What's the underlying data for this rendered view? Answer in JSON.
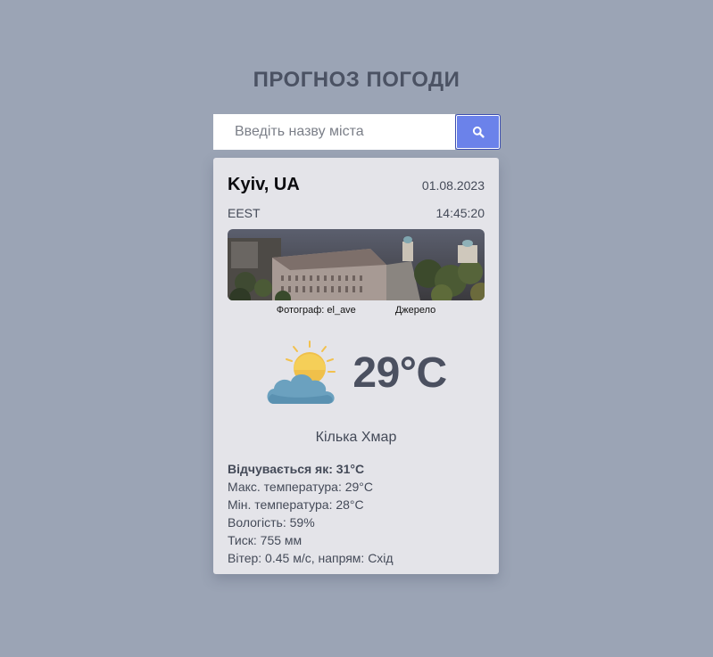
{
  "app": {
    "title": "ПРОГНОЗ ПОГОДИ"
  },
  "search": {
    "placeholder": "Введіть назву міста",
    "value": "",
    "button_icon": "search-icon"
  },
  "weather": {
    "city": "Kyiv, UA",
    "date": "01.08.2023",
    "timezone": "EEST",
    "time": "14:45:20",
    "photo_credit": "Фотограф: el_ave",
    "photo_source": "Джерело",
    "icon": "partly-cloudy-icon",
    "temperature": "29°C",
    "description": "Кілька Хмар",
    "feels_like_label": "Відчувається як:",
    "feels_like_value": "31°C",
    "max_temp": "Макс. температура: 29°C",
    "min_temp": "Мін. температура: 28°C",
    "humidity": "Вологість: 59%",
    "pressure": "Тиск: 755 мм",
    "wind": "Вітер: 0.45 м/с, напрям: Схід"
  },
  "colors": {
    "background": "#9ba4b5",
    "card": "#e4e4e9",
    "accent": "#6b82ea",
    "text": "#444a58"
  }
}
